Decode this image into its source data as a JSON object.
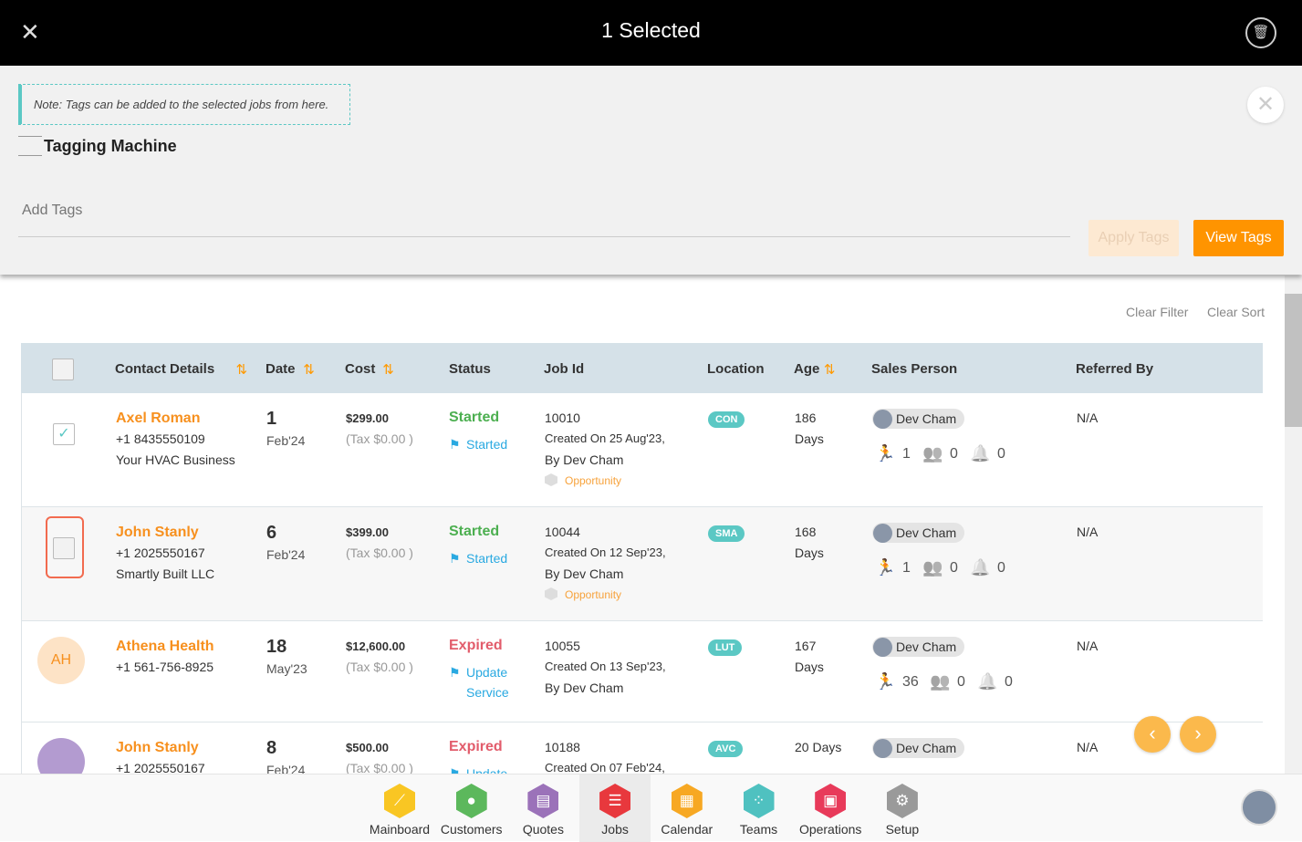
{
  "header": {
    "title": "1 Selected",
    "close_icon": "close-icon",
    "trash_icon": "trash-icon"
  },
  "tagging": {
    "note": "Note: Tags can be added to the selected jobs from here.",
    "title": "Tagging Machine",
    "placeholder": "Add Tags",
    "apply_label": "Apply Tags",
    "view_label": "View Tags"
  },
  "filters": {
    "clear_filter": "Clear Filter",
    "clear_sort": "Clear Sort"
  },
  "columns": [
    "Contact Details",
    "Date",
    "Cost",
    "Status",
    "Job Id",
    "Location",
    "Age",
    "Sales Person",
    "Referred By"
  ],
  "rows": [
    {
      "checked": true,
      "name": "Axel Roman",
      "phone": "+1 8435550109",
      "company": "Your HVAC Business",
      "day": "1",
      "month": "Feb'24",
      "cost": "$299.00",
      "tax": "(Tax $0.00 )",
      "status": "Started",
      "sub_status": [
        "Started"
      ],
      "job_id": "10010",
      "created": "Created On 25 Aug'23,",
      "by": "By Dev Cham",
      "tag": "Opportunity",
      "location": "CON",
      "age": [
        "186",
        "Days"
      ],
      "sales": "Dev Cham",
      "counts": [
        "1",
        "0",
        "0"
      ],
      "referred": "N/A"
    },
    {
      "checked": false,
      "focused": true,
      "name": "John Stanly",
      "phone": "+1 2025550167",
      "company": "Smartly Built LLC",
      "day": "6",
      "month": "Feb'24",
      "cost": "$399.00",
      "tax": "(Tax $0.00 )",
      "status": "Started",
      "sub_status": [
        "Started"
      ],
      "job_id": "10044",
      "created": "Created On 12 Sep'23,",
      "by": "By Dev Cham",
      "tag": "Opportunity",
      "location": "SMA",
      "age": [
        "168",
        "Days"
      ],
      "sales": "Dev Cham",
      "counts": [
        "1",
        "0",
        "0"
      ],
      "referred": "N/A"
    },
    {
      "avatar": "AH",
      "name": "Athena Health",
      "phone": "+1 561-756-8925",
      "company": "",
      "day": "18",
      "month": "May'23",
      "cost": "$12,600.00",
      "tax": "(Tax $0.00 )",
      "status": "Expired",
      "sub_status": [
        "Update",
        "Service"
      ],
      "job_id": "10055",
      "created": "Created On 13 Sep'23,",
      "by": "By Dev Cham",
      "tag": "",
      "location": "LUT",
      "age": [
        "167",
        "Days"
      ],
      "sales": "Dev Cham",
      "counts": [
        "36",
        "0",
        "0"
      ],
      "referred": "N/A"
    },
    {
      "avatar_photo": true,
      "name": "John Stanly",
      "phone": "+1 2025550167",
      "company": "",
      "day": "8",
      "month": "Feb'24",
      "cost": "$500.00",
      "tax": "(Tax $0.00 )",
      "status": "Expired",
      "sub_status": [
        "Update"
      ],
      "job_id": "10188",
      "created": "Created On 07 Feb'24,",
      "by": "",
      "tag": "",
      "location": "AVC",
      "age": [
        "20 Days"
      ],
      "sales": "Dev Cham",
      "counts": [],
      "referred": "N/A"
    }
  ],
  "colors": {
    "accent": "#ff9800",
    "started": "#4caf50",
    "expired": "#e25c6b",
    "link": "#29a9e1",
    "badge": "#5bc8c4"
  },
  "nav": [
    {
      "label": "Mainboard",
      "color": "#f9c623",
      "icon": "mainboard-icon",
      "glyph": "⟋"
    },
    {
      "label": "Customers",
      "color": "#5cb85c",
      "icon": "customer-icon",
      "glyph": "●"
    },
    {
      "label": "Quotes",
      "color": "#9b72b9",
      "icon": "quotes-icon",
      "glyph": "▤"
    },
    {
      "label": "Jobs",
      "color": "#e8383d",
      "icon": "jobs-icon",
      "glyph": "☰",
      "active": true
    },
    {
      "label": "Calendar",
      "color": "#f7a823",
      "icon": "calendar-icon",
      "glyph": "▦"
    },
    {
      "label": "Teams",
      "color": "#4fc1c0",
      "icon": "teams-icon",
      "glyph": "⁘"
    },
    {
      "label": "Operations",
      "color": "#e83a5a",
      "icon": "briefcase-icon",
      "glyph": "▣"
    },
    {
      "label": "Setup",
      "color": "#9a9a9a",
      "icon": "gear-icon",
      "glyph": "⚙"
    }
  ]
}
